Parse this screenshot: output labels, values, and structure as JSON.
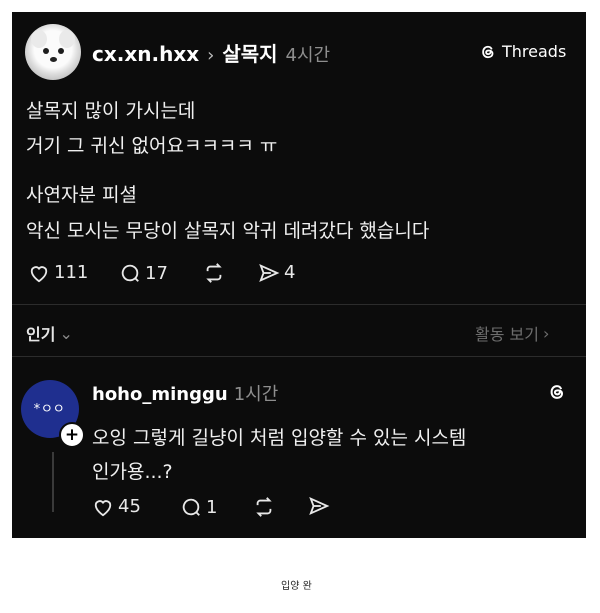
{
  "post": {
    "username": "cx.xn.hxx",
    "separator": "›",
    "topic": "살목지",
    "time": "4시간",
    "brand": "Threads",
    "lines": [
      "살목지 많이 가시는데",
      "거기 그 귀신 없어요ㅋㅋㅋㅋ ㅠ",
      "사연자분 피셜",
      "악신 모시는 무당이 살목지 악귀 데려갔다 했습니다"
    ],
    "stats": {
      "likes": "111",
      "comments": "17",
      "reposts": "",
      "shares": "4"
    }
  },
  "sort_bar": {
    "sort_label": "인기",
    "sort_chevron": "⌄",
    "activity_label": "활동 보기",
    "activity_chevron": "›"
  },
  "reply": {
    "username": "hoho_minggu",
    "time": "1시간",
    "avatar_face": "*ㅇㅇ",
    "lines": [
      "오잉 그렇게 길냥이 처럼 입양할 수 있는 시스템",
      "인가용...?"
    ],
    "stats": {
      "likes": "45",
      "comments": "1"
    }
  },
  "caption": "입양 완",
  "icons": {
    "heart": "heart-icon",
    "comment": "comment-icon",
    "repost": "repost-icon",
    "share": "share-icon",
    "threads_logo": "threads-logo-icon"
  }
}
